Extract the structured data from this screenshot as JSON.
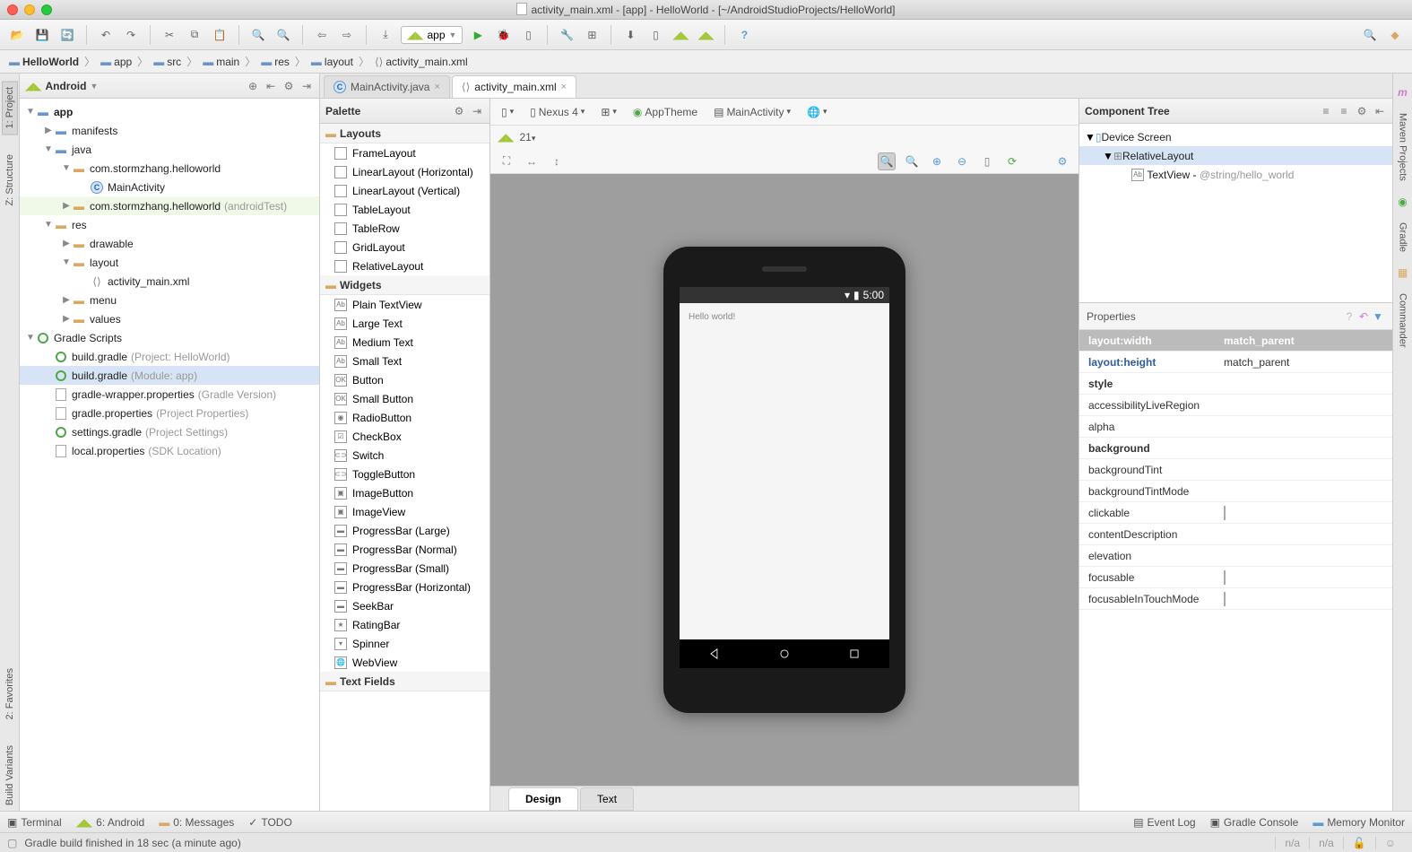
{
  "window": {
    "title": "activity_main.xml - [app] - HelloWorld - [~/AndroidStudioProjects/HelloWorld]"
  },
  "toolbar": {
    "app_config": "app"
  },
  "breadcrumb": [
    "HelloWorld",
    "app",
    "src",
    "main",
    "res",
    "layout",
    "activity_main.xml"
  ],
  "left_gutter": [
    "1: Project",
    "Z: Structure"
  ],
  "left_gutter_low": [
    "2: Favorites",
    "Build Variants"
  ],
  "right_gutter": [
    "Maven Projects",
    "Gradle",
    "Commander"
  ],
  "project_panel": {
    "title": "Android",
    "tree": {
      "app": "app",
      "manifests": "manifests",
      "java": "java",
      "pkg1": "com.stormzhang.helloworld",
      "main_activity": "MainActivity",
      "pkg2": "com.stormzhang.helloworld",
      "pkg2_hint": "(androidTest)",
      "res": "res",
      "drawable": "drawable",
      "layout": "layout",
      "activity_main": "activity_main.xml",
      "menu": "menu",
      "values": "values",
      "gradle_scripts": "Gradle Scripts",
      "bg1": "build.gradle",
      "bg1_hint": "(Project: HelloWorld)",
      "bg2": "build.gradle",
      "bg2_hint": "(Module: app)",
      "gwp": "gradle-wrapper.properties",
      "gwp_hint": "(Gradle Version)",
      "gp": "gradle.properties",
      "gp_hint": "(Project Properties)",
      "sg": "settings.gradle",
      "sg_hint": "(Project Settings)",
      "lp": "local.properties",
      "lp_hint": "(SDK Location)"
    }
  },
  "editor_tabs": {
    "t1": "MainActivity.java",
    "t2": "activity_main.xml"
  },
  "palette": {
    "title": "Palette",
    "layouts_group": "Layouts",
    "layouts": [
      "FrameLayout",
      "LinearLayout (Horizontal)",
      "LinearLayout (Vertical)",
      "TableLayout",
      "TableRow",
      "GridLayout",
      "RelativeLayout"
    ],
    "widgets_group": "Widgets",
    "widgets": [
      "Plain TextView",
      "Large Text",
      "Medium Text",
      "Small Text",
      "Button",
      "Small Button",
      "RadioButton",
      "CheckBox",
      "Switch",
      "ToggleButton",
      "ImageButton",
      "ImageView",
      "ProgressBar (Large)",
      "ProgressBar (Normal)",
      "ProgressBar (Small)",
      "ProgressBar (Horizontal)",
      "SeekBar",
      "RatingBar",
      "Spinner",
      "WebView"
    ],
    "textfields_group": "Text Fields"
  },
  "design_toolbar": {
    "device": "Nexus 4",
    "theme": "AppTheme",
    "activity": "MainActivity",
    "api": "21"
  },
  "preview": {
    "status_time": "5:00",
    "hello_text": "Hello world!"
  },
  "design_tabs": {
    "design": "Design",
    "text": "Text"
  },
  "comp_tree": {
    "title": "Component Tree",
    "device_screen": "Device Screen",
    "relative_layout": "RelativeLayout",
    "textview_label": "TextView",
    "textview_val": "@string/hello_world"
  },
  "properties": {
    "title": "Properties",
    "header_name": "layout:width",
    "header_val": "match_parent",
    "rows": [
      {
        "name": "layout:height",
        "val": "match_parent",
        "blue": true
      },
      {
        "name": "style",
        "val": "",
        "bold": true
      },
      {
        "name": "accessibilityLiveRegion",
        "val": ""
      },
      {
        "name": "alpha",
        "val": ""
      },
      {
        "name": "background",
        "val": "",
        "bold": true
      },
      {
        "name": "backgroundTint",
        "val": ""
      },
      {
        "name": "backgroundTintMode",
        "val": ""
      },
      {
        "name": "clickable",
        "val": "",
        "chk": true
      },
      {
        "name": "contentDescription",
        "val": ""
      },
      {
        "name": "elevation",
        "val": ""
      },
      {
        "name": "focusable",
        "val": "",
        "chk": true
      },
      {
        "name": "focusableInTouchMode",
        "val": "",
        "chk": true
      }
    ]
  },
  "bottom_bar": {
    "terminal": "Terminal",
    "android": "6: Android",
    "messages": "0: Messages",
    "todo": "TODO",
    "event_log": "Event Log",
    "gradle_console": "Gradle Console",
    "memory_monitor": "Memory Monitor"
  },
  "status": {
    "msg": "Gradle build finished in 18 sec (a minute ago)",
    "na1": "n/a",
    "na2": "n/a"
  }
}
